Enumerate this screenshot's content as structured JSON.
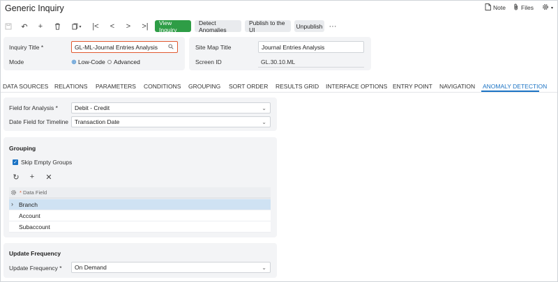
{
  "window": {
    "title": "Generic Inquiry"
  },
  "topbar": {
    "note_label": "Note",
    "files_label": "Files"
  },
  "toolbar": {
    "view_inquiry": "View Inquiry",
    "detect_anomalies": "Detect Anomalies",
    "publish": "Publish to the UI",
    "unpublish": "Unpublish",
    "more": "···"
  },
  "header_form": {
    "inquiry_title_label": "Inquiry Title *",
    "inquiry_title_value": "GL-ML-Journal Entries Analysis",
    "mode_label": "Mode",
    "mode_low_code": "Low-Code",
    "mode_advanced": "Advanced",
    "mode_selected": "Low-Code",
    "site_map_title_label": "Site Map Title",
    "site_map_title_value": "Journal Entries Analysis",
    "screen_id_label": "Screen ID",
    "screen_id_value": "GL.30.10.ML"
  },
  "tabs": [
    {
      "label": "DATA SOURCES"
    },
    {
      "label": "RELATIONS"
    },
    {
      "label": "PARAMETERS"
    },
    {
      "label": "CONDITIONS"
    },
    {
      "label": "GROUPING"
    },
    {
      "label": "SORT ORDER"
    },
    {
      "label": "RESULTS GRID"
    },
    {
      "label": "INTERFACE OPTIONS"
    },
    {
      "label": "ENTRY POINT"
    },
    {
      "label": "NAVIGATION"
    },
    {
      "label": "ANOMALY DETECTION"
    }
  ],
  "active_tab": "ANOMALY DETECTION",
  "analysis": {
    "field_label": "Field for Analysis *",
    "field_value": "Debit - Credit",
    "date_label": "Date Field for Timeline",
    "date_value": "Transaction Date"
  },
  "grouping": {
    "title": "Grouping",
    "skip_empty_label": "Skip Empty Groups",
    "skip_empty_checked": true,
    "column_header": "Data Field",
    "required_mark": "*",
    "rows": [
      {
        "label": "Branch",
        "selected": true
      },
      {
        "label": "Account",
        "selected": false
      },
      {
        "label": "Subaccount",
        "selected": false
      }
    ]
  },
  "update": {
    "title": "Update Frequency",
    "label": "Update Frequency *",
    "value": "On Demand"
  },
  "colors": {
    "accent": "#1b73c4",
    "primary_button": "#2e9d46",
    "focus_border": "#e0592f"
  }
}
